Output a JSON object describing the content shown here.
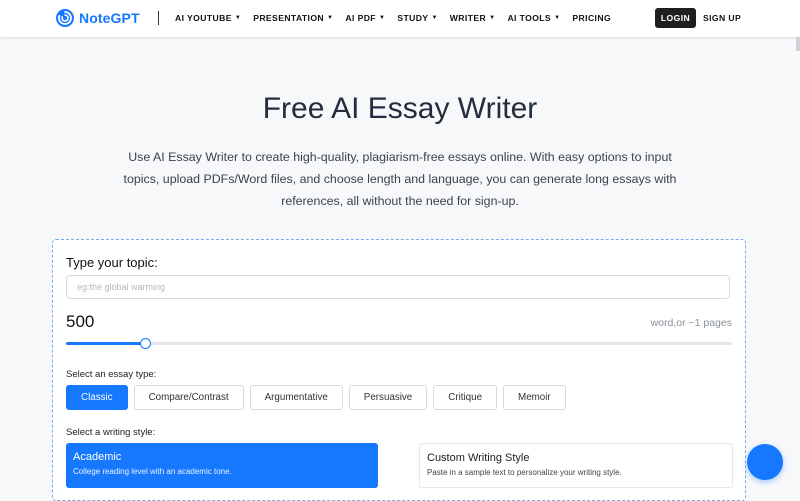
{
  "header": {
    "logo_text": "NoteGPT",
    "nav": [
      {
        "label": "AI YOUTUBE"
      },
      {
        "label": "PRESENTATION"
      },
      {
        "label": "AI PDF"
      },
      {
        "label": "STUDY"
      },
      {
        "label": "WRITER"
      },
      {
        "label": "AI TOOLS"
      },
      {
        "label": "PRICING"
      }
    ],
    "login": "LOGIN",
    "signup": "SIGN UP"
  },
  "hero": {
    "title": "Free AI Essay Writer",
    "description": "Use AI Essay Writer to create high-quality, plagiarism-free essays online. With easy options to input topics, upload PDFs/Word files, and choose length and language, you can generate long essays with references, all without the need for sign-up."
  },
  "form": {
    "topic_label": "Type your topic:",
    "topic_placeholder": "eg:the global warming",
    "topic_value": "",
    "word_count": "500",
    "word_count_note": "word,or ~1 pages",
    "slider_fraction": 0.118,
    "essay_type_label": "Select an essay type:",
    "essay_types": [
      "Classic",
      "Compare/Contrast",
      "Argumentative",
      "Persuasive",
      "Critique",
      "Memoir"
    ],
    "selected_essay_type": "Classic",
    "writing_style_label": "Select a writing style:",
    "styles": [
      {
        "name": "Academic",
        "desc": "College reading level with an academic tone."
      },
      {
        "name": "Custom Writing Style",
        "desc": "Paste in a sample text to personalize your writing style."
      }
    ]
  },
  "colors": {
    "accent": "#1677ff",
    "dark": "#1f1f1f",
    "title": "#222d3d"
  }
}
